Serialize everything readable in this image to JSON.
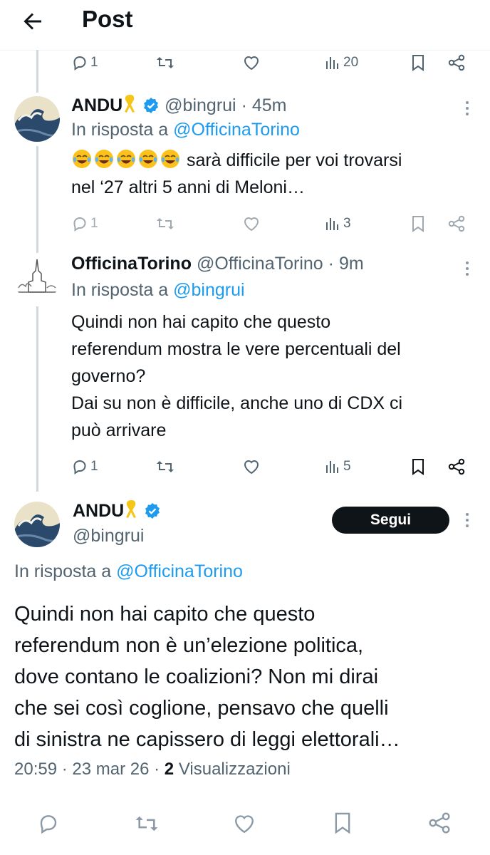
{
  "header": {
    "title": "Post"
  },
  "thread_top": {
    "actions": {
      "reply": "1",
      "views": "20"
    }
  },
  "reply1": {
    "name": "ANDU",
    "handle": "@bingrui",
    "time": "· 45m",
    "reply_prefix": "In risposta a",
    "reply_to": "@OfficinaTorino",
    "emojis": [
      "😂",
      "😂",
      "😂",
      "😂",
      "😂"
    ],
    "text_line1": "sarà difficile per voi trovarsi",
    "text_line2": "nel ‘27 altri 5 anni di Meloni…",
    "actions": {
      "reply": "1",
      "views": "3"
    }
  },
  "reply2": {
    "name": "OfficinaTorino",
    "handle": "@OfficinaTorino",
    "time": "· 9m",
    "reply_prefix": "In risposta a",
    "reply_to": "@bingrui",
    "lines": [
      "Quindi non hai capito che questo",
      "referendum mostra le vere percentuali del",
      "governo?",
      "Dai su non è difficile, anche uno di CDX ci",
      "può arrivare"
    ],
    "actions": {
      "reply": "1",
      "views": "5"
    }
  },
  "main_post": {
    "name": "ANDU",
    "handle": "@bingrui",
    "follow_label": "Segui",
    "reply_prefix": "In risposta a",
    "reply_to": "@OfficinaTorino",
    "lines": [
      "Quindi non hai capito che questo",
      "referendum non è un’elezione politica,",
      "dove contano le coalizioni? Non mi dirai",
      "che sei così coglione, pensavo che quelli",
      "di sinistra ne capissero di leggi elettorali…"
    ],
    "time": "20:59 · 23 mar 26 ·",
    "views_count": "2",
    "views_label": "Visualizzazioni"
  },
  "colors": {
    "link": "#1d9bf0",
    "muted": "#536471",
    "text": "#0f1419",
    "verified": "#1d9bf0",
    "ribbon": "#f5c518"
  },
  "icons": [
    "back-arrow-icon",
    "reply-icon",
    "repost-icon",
    "like-icon",
    "views-icon",
    "bookmark-icon",
    "share-icon",
    "verified-icon",
    "yellow-ribbon-icon",
    "more-icon"
  ]
}
